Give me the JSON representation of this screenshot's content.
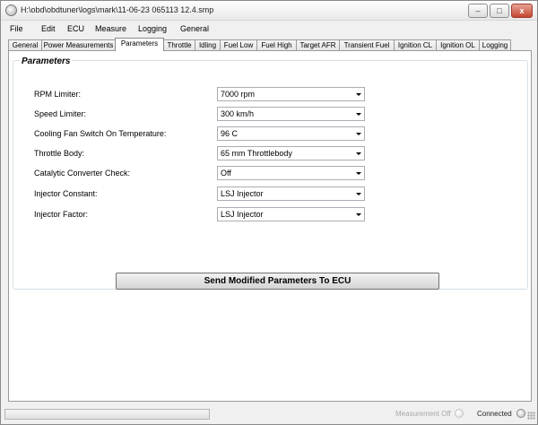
{
  "window": {
    "title": "H:\\obd\\obdtuner\\logs\\mark\\11-06-23 065113 12.4.smp",
    "minimize_glyph": "–",
    "maximize_glyph": "□",
    "close_glyph": "x"
  },
  "menu": [
    "File",
    "Edit",
    "ECU",
    "Measure",
    "Logging",
    "General"
  ],
  "tabs": [
    {
      "label": "General",
      "active": false
    },
    {
      "label": "Power Measurements",
      "active": false
    },
    {
      "label": "Parameters",
      "active": true
    },
    {
      "label": "Throttle",
      "active": false
    },
    {
      "label": "Idling",
      "active": false
    },
    {
      "label": "Fuel Low",
      "active": false
    },
    {
      "label": "Fuel High",
      "active": false
    },
    {
      "label": "Target AFR",
      "active": false
    },
    {
      "label": "Transient Fuel",
      "active": false
    },
    {
      "label": "Ignition CL",
      "active": false
    },
    {
      "label": "Ignition OL",
      "active": false
    },
    {
      "label": "Logging",
      "active": false
    }
  ],
  "parameters": {
    "title": "Parameters",
    "fields": [
      {
        "label": "RPM Limiter:",
        "value": "7000 rpm"
      },
      {
        "label": "Speed Limiter:",
        "value": "300 km/h"
      },
      {
        "label": "Cooling Fan Switch On Temperature:",
        "value": "96 C"
      },
      {
        "label": "Throttle Body:",
        "value": "65 mm Throttlebody"
      },
      {
        "label": "Catalytic Converter Check:",
        "value": "Off"
      },
      {
        "label": "Injector Constant:",
        "value": "LSJ Injector"
      },
      {
        "label": "Injector Factor:",
        "value": "LSJ Injector"
      }
    ],
    "send_button": "Send Modified Parameters To ECU"
  },
  "status": {
    "measurement": "Measurement Off",
    "connection": "Connected"
  }
}
